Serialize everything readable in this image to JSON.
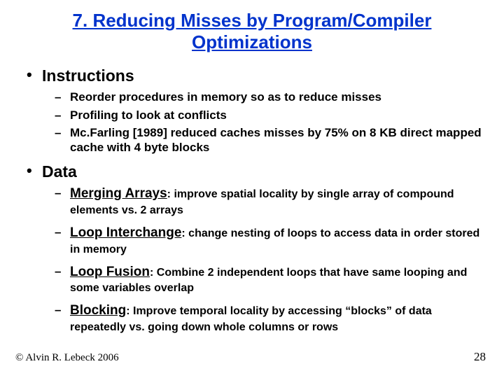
{
  "title": "7. Reducing Misses by Program/Compiler Optimizations",
  "sections": {
    "instructions": {
      "heading": "Instructions",
      "items": [
        "Reorder procedures in memory so as to reduce misses",
        "Profiling to look at conflicts",
        "Mc.Farling [1989] reduced caches misses by 75% on 8 KB direct mapped cache with 4 byte blocks"
      ]
    },
    "data": {
      "heading": "Data",
      "items": [
        {
          "term": "Merging Arrays",
          "desc": ": improve spatial locality by single array of compound elements vs. 2 arrays"
        },
        {
          "term": "Loop Interchange",
          "desc": ": change nesting of loops to access data in order stored in memory"
        },
        {
          "term": "Loop Fusion",
          "desc": ": Combine 2 independent loops that have same looping and some variables overlap"
        },
        {
          "term": "Blocking",
          "desc": ": Improve temporal locality by accessing “blocks” of data repeatedly vs. going down whole columns or rows"
        }
      ]
    }
  },
  "footer": {
    "copyright": "© Alvin R. Lebeck 2006",
    "page": "28"
  }
}
